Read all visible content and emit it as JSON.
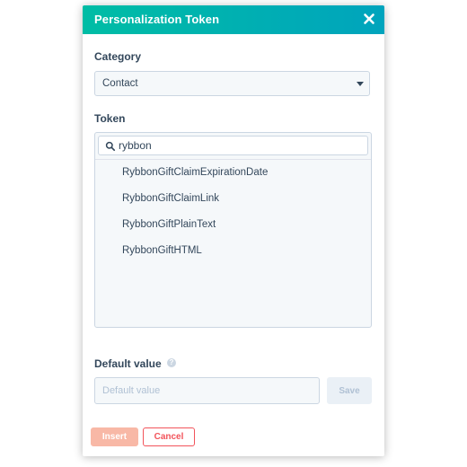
{
  "modal": {
    "title": "Personalization Token",
    "close_icon": "close-icon"
  },
  "category": {
    "label": "Category",
    "selected": "Contact",
    "caret_icon": "caret-down-icon"
  },
  "token": {
    "label": "Token",
    "search_icon": "search-icon",
    "search_value": "rybbon",
    "results": [
      "RybbonGiftClaimExpirationDate",
      "RybbonGiftClaimLink",
      "RybbonGiftPlainText",
      "RybbonGiftHTML"
    ]
  },
  "default_value": {
    "label": "Default value",
    "help_icon": "help-icon",
    "placeholder": "Default value",
    "save_label": "Save"
  },
  "footer": {
    "insert_label": "Insert",
    "cancel_label": "Cancel"
  },
  "colors": {
    "header_gradient_start": "#00bda5",
    "header_gradient_end": "#00a4bd",
    "text_primary": "#33475b",
    "insert_disabled": "#f8b8a6",
    "cancel_accent": "#f2545b",
    "input_bg": "#f5f8fa",
    "border": "#cbd6e2"
  }
}
